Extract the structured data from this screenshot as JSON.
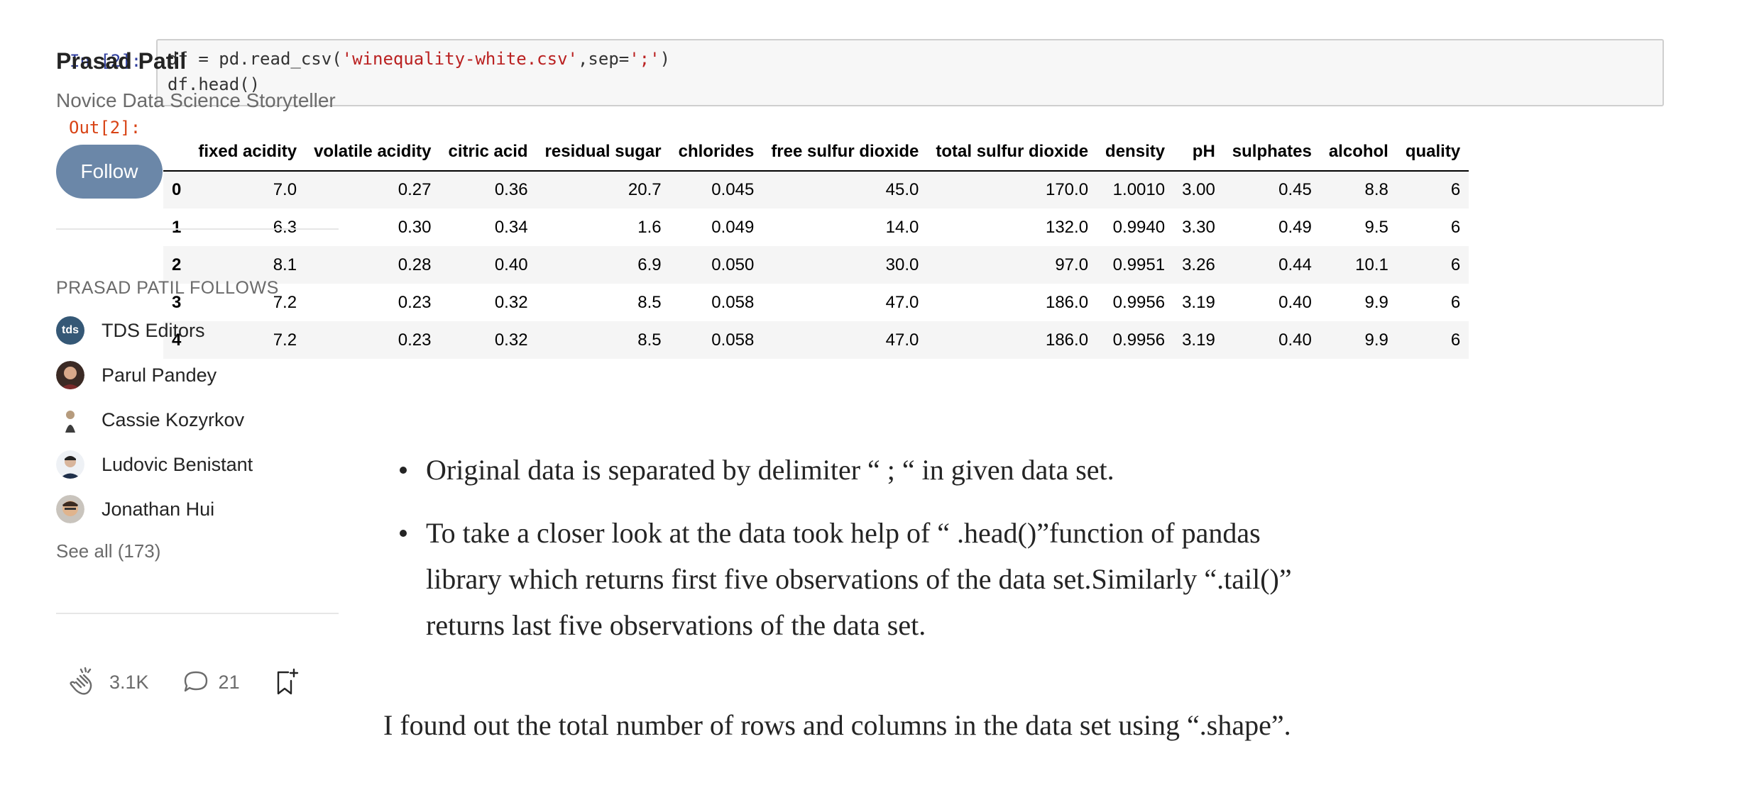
{
  "notebook": {
    "in_prompt": "In [2]:",
    "code_line1_a": "df = pd.read_csv(",
    "code_line1_str1": "'winequality-white.csv'",
    "code_line1_b": ",sep=",
    "code_line1_str2": "';'",
    "code_line1_c": ")",
    "code_line2": "df.head()",
    "out_prompt": "Out[2]:"
  },
  "dataframe": {
    "columns": [
      "",
      "fixed acidity",
      "volatile acidity",
      "citric acid",
      "residual sugar",
      "chlorides",
      "free sulfur dioxide",
      "total sulfur dioxide",
      "density",
      "pH",
      "sulphates",
      "alcohol",
      "quality"
    ],
    "rows": [
      [
        "0",
        "7.0",
        "0.27",
        "0.36",
        "20.7",
        "0.045",
        "45.0",
        "170.0",
        "1.0010",
        "3.00",
        "0.45",
        "8.8",
        "6"
      ],
      [
        "1",
        "6.3",
        "0.30",
        "0.34",
        "1.6",
        "0.049",
        "14.0",
        "132.0",
        "0.9940",
        "3.30",
        "0.49",
        "9.5",
        "6"
      ],
      [
        "2",
        "8.1",
        "0.28",
        "0.40",
        "6.9",
        "0.050",
        "30.0",
        "97.0",
        "0.9951",
        "3.26",
        "0.44",
        "10.1",
        "6"
      ],
      [
        "3",
        "7.2",
        "0.23",
        "0.32",
        "8.5",
        "0.058",
        "47.0",
        "186.0",
        "0.9956",
        "3.19",
        "0.40",
        "9.9",
        "6"
      ],
      [
        "4",
        "7.2",
        "0.23",
        "0.32",
        "8.5",
        "0.058",
        "47.0",
        "186.0",
        "0.9956",
        "3.19",
        "0.40",
        "9.9",
        "6"
      ]
    ]
  },
  "article": {
    "bullets": [
      "Original data is separated by delimiter “ ; “ in given data set.",
      "To take a closer look at the data took help of “ .head()”function of pandas library which returns first five observations of the data set.Similarly “.tail()” returns last five observations of the data set."
    ],
    "paragraph": "I found out the total number of rows and columns in the data set using “.shape”."
  },
  "sidebar": {
    "author_name": "Prasad Patil",
    "author_bio": "Novice Data Science Storyteller",
    "follow_label": "Follow",
    "follows_heading": "PRASAD PATIL FOLLOWS",
    "follows": [
      {
        "name": "TDS Editors",
        "avatar": "tds"
      },
      {
        "name": "Parul Pandey",
        "avatar": "person"
      },
      {
        "name": "Cassie Kozyrkov",
        "avatar": "person"
      },
      {
        "name": "Ludovic Benistant",
        "avatar": "person"
      },
      {
        "name": "Jonathan Hui",
        "avatar": "person"
      }
    ],
    "see_all": "See all (173)"
  },
  "actions": {
    "claps": "3.1K",
    "responses": "21"
  },
  "colors": {
    "follow_button": "#6b87a8",
    "in_prompt": "#303f9f",
    "out_prompt": "#d84315",
    "code_string": "#ba2121",
    "tds_avatar": "#355876"
  }
}
